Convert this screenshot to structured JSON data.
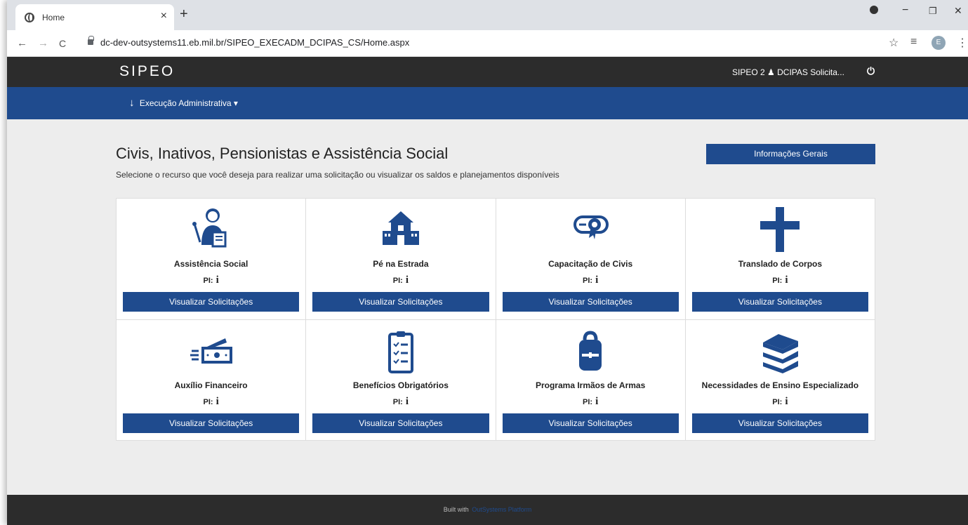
{
  "browser": {
    "tab_title": "Home",
    "tab_close": "×",
    "new_tab": "+",
    "url": "dc-dev-outsystems11.eb.mil.br/SIPEO_EXECADM_DCIPAS_CS/Home.aspx",
    "avatar_letter": "E",
    "back": "←",
    "forward": "→",
    "reload": "C",
    "star": "☆",
    "media": "≡",
    "more": "⋮",
    "minimize": "−",
    "restore": "❐",
    "close": "✕"
  },
  "header": {
    "logo": "SIPEO",
    "user_text": "SIPEO 2  ♟ DCIPAS Solicita...",
    "power_icon": "⏻"
  },
  "menu": {
    "sort_icon": "↓",
    "item_label": "Execução Administrativa ▾"
  },
  "main": {
    "title": "Civis, Inativos, Pensionistas e Assistência Social",
    "subtitle": "Selecione o recurso que você deseja para realizar uma solicitação ou visualizar os saldos e planejamentos disponíveis",
    "info_button": "Informações Gerais"
  },
  "cards": [
    {
      "name": "Assistência Social",
      "pi_label": "PI:",
      "info": "i",
      "button": "Visualizar Solicitações",
      "icon": "teacher-icon"
    },
    {
      "name": "Pé na Estrada",
      "pi_label": "PI:",
      "info": "i",
      "button": "Visualizar Solicitações",
      "icon": "school-icon"
    },
    {
      "name": "Capacitação de Civis",
      "pi_label": "PI:",
      "info": "i",
      "button": "Visualizar Solicitações",
      "icon": "certificate-icon"
    },
    {
      "name": "Translado de Corpos",
      "pi_label": "PI:",
      "info": "i",
      "button": "Visualizar Solicitações",
      "icon": "cross-icon"
    },
    {
      "name": "Auxílio Financeiro",
      "pi_label": "PI:",
      "info": "i",
      "button": "Visualizar Solicitações",
      "icon": "money-icon"
    },
    {
      "name": "Benefícios Obrigatórios",
      "pi_label": "PI:",
      "info": "i",
      "button": "Visualizar Solicitações",
      "icon": "clipboard-icon"
    },
    {
      "name": "Programa Irmãos de Armas",
      "pi_label": "PI:",
      "info": "i",
      "button": "Visualizar Solicitações",
      "icon": "backpack-icon"
    },
    {
      "name": "Necessidades de Ensino Especializado",
      "pi_label": "PI:",
      "info": "i",
      "button": "Visualizar Solicitações",
      "icon": "books-icon"
    }
  ],
  "footer": {
    "built_with": "Built with",
    "platform": "OutSystems Platform"
  },
  "colors": {
    "primary": "#1f4b8e",
    "header": "#2c2c2c",
    "background": "#ededed"
  }
}
